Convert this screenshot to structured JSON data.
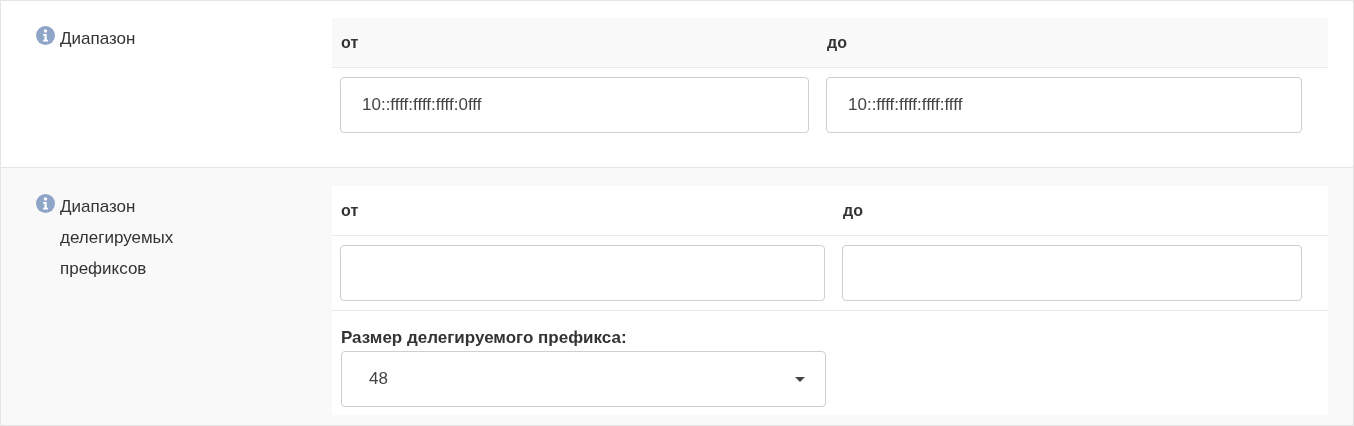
{
  "sections": [
    {
      "label": "Диапазон",
      "columns": [
        {
          "heading": "от",
          "value": "10::ffff:ffff:ffff:0fff"
        },
        {
          "heading": "до",
          "value": "10::ffff:ffff:ffff:ffff"
        }
      ]
    },
    {
      "label": "Диапазон делегируемых префиксов",
      "columns": [
        {
          "heading": "от"
        },
        {
          "heading": "до"
        }
      ],
      "select": {
        "label": "Размер делегируемого префикса:",
        "value": "48"
      }
    }
  ]
}
